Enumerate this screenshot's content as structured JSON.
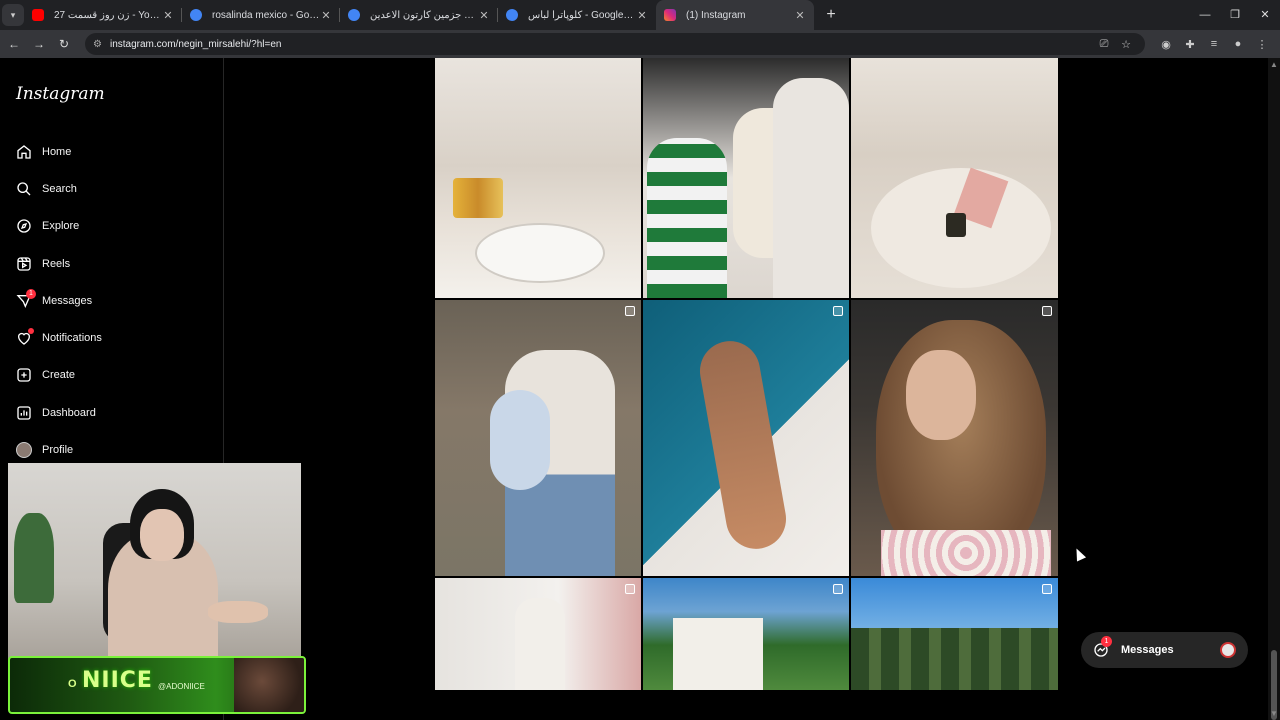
{
  "browser": {
    "tabs": [
      {
        "title": "زن روز قسمت 27 - YouTube",
        "favicon_color": "#ff0000"
      },
      {
        "title": "rosalinda mexico - Google Search",
        "favicon_color": "#4285f4"
      },
      {
        "title": "پرنسس جزمین کارتون الاعدین - Search",
        "favicon_color": "#4285f4"
      },
      {
        "title": "کلوپاترا لباس - Google Search",
        "favicon_color": "#4285f4"
      },
      {
        "title": "(1) Instagram",
        "favicon_color": "#e1306c"
      }
    ],
    "active_tab_index": 4,
    "new_tab_label": "+",
    "url": "instagram.com/negin_mirsalehi/?hl=en"
  },
  "sidebar": {
    "logo": "Instagram",
    "items": [
      {
        "label": "Home",
        "icon": "home-icon"
      },
      {
        "label": "Search",
        "icon": "search-icon"
      },
      {
        "label": "Explore",
        "icon": "compass-icon"
      },
      {
        "label": "Reels",
        "icon": "reels-icon"
      },
      {
        "label": "Messages",
        "icon": "messenger-icon",
        "badge": "1"
      },
      {
        "label": "Notifications",
        "icon": "heart-icon",
        "dot": true
      },
      {
        "label": "Create",
        "icon": "plus-square-icon"
      },
      {
        "label": "Dashboard",
        "icon": "bar-chart-icon"
      },
      {
        "label": "Profile",
        "icon": "avatar"
      }
    ]
  },
  "stream_overlay": {
    "banner_title": "NIICE",
    "banner_prefix": "O",
    "banner_handle": "@ADONIICE"
  },
  "feed": {
    "posts": [
      {
        "desc": "bathroom vanity",
        "multi": false
      },
      {
        "desc": "family with baby",
        "multi": false
      },
      {
        "desc": "notebook on table",
        "multi": false
      },
      {
        "desc": "mother holding baby",
        "multi": true
      },
      {
        "desc": "poolside",
        "multi": true
      },
      {
        "desc": "portrait with curls",
        "multi": true
      },
      {
        "desc": "mirror selfie",
        "multi": true
      },
      {
        "desc": "garden pergola",
        "multi": true
      },
      {
        "desc": "trees and sky",
        "multi": true
      }
    ]
  },
  "messages_pill": {
    "label": "Messages",
    "badge": "1"
  },
  "colors": {
    "accent": "#ff3040",
    "background": "#000000",
    "sidebar_border": "#262626"
  }
}
